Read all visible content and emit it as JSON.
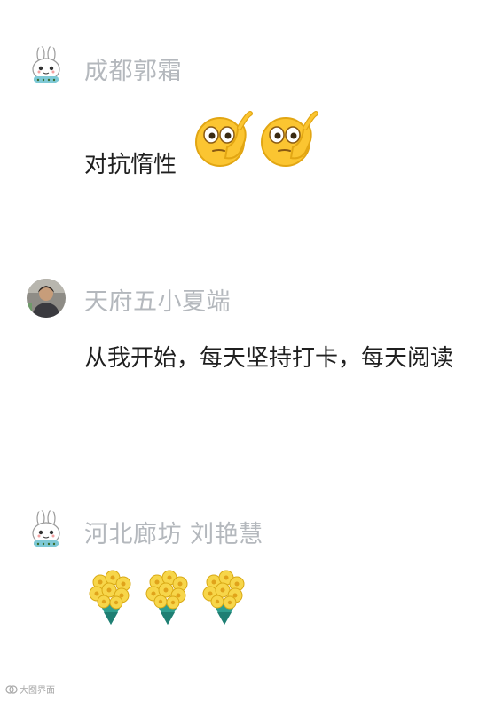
{
  "comments": [
    {
      "author": "成都郭霜",
      "text": "对抗惰性",
      "avatar_icon": "cartoon-rabbit-avatar",
      "emojis": [
        "thinking-hand-on-chin-emoji",
        "thinking-hand-on-chin-emoji"
      ]
    },
    {
      "author": "天府五小夏端",
      "text": "从我开始，每天坚持打卡，每天阅读",
      "avatar_icon": "photo-avatar"
    },
    {
      "author": "河北廊坊 刘艳慧",
      "avatar_icon": "cartoon-rabbit-avatar",
      "emojis": [
        "flower-bouquet-emoji",
        "flower-bouquet-emoji",
        "flower-bouquet-emoji"
      ]
    }
  ],
  "watermark": "大图界面",
  "colors": {
    "author_name": "#b4b8bd",
    "comment_text": "#1f1f1f",
    "emoji_yellow": "#fbc531",
    "bouquet_green": "#2f9e8f"
  }
}
